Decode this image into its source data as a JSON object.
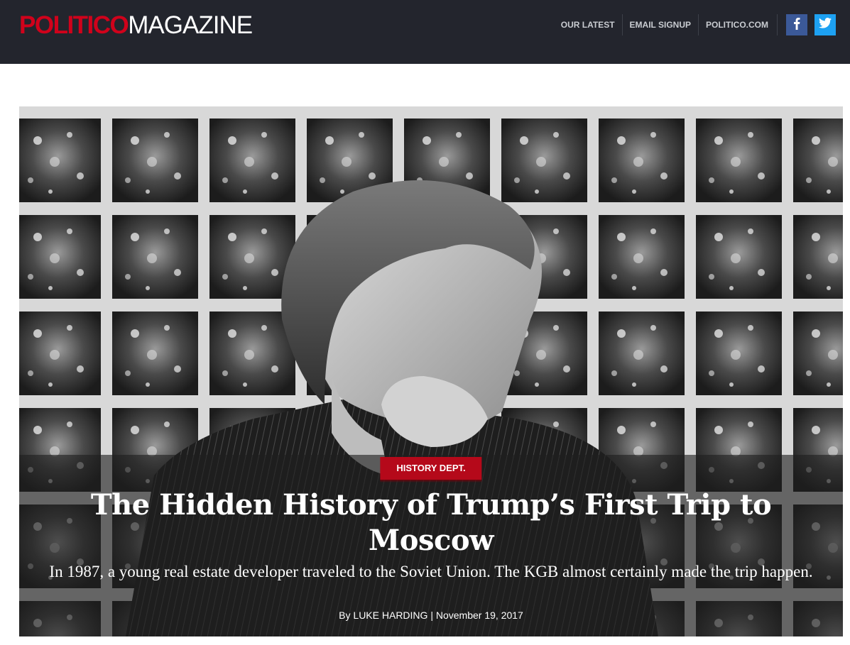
{
  "header": {
    "logo": {
      "part1": "POLITICO",
      "part2": "MAGAZINE"
    },
    "nav": [
      {
        "label": "OUR LATEST"
      },
      {
        "label": "EMAIL SIGNUP"
      },
      {
        "label": "POLITICO.COM"
      }
    ],
    "social": [
      {
        "name": "facebook-icon",
        "glyph": "f",
        "color": "#3b5998"
      },
      {
        "name": "twitter-icon",
        "glyph": "twitter-bird",
        "color": "#1da1f2"
      }
    ]
  },
  "hero": {
    "kicker": "HISTORY DEPT.",
    "headline": "The Hidden History of Trump’s First Trip to Moscow",
    "dek": "In 1987, a young real estate developer traveled to the Soviet Union. The KGB almost certainly made the trip happen.",
    "byline": {
      "prefix": "By",
      "author": "LUKE HARDING",
      "separator": "|",
      "date": "November 19, 2017"
    }
  },
  "colors": {
    "header_bg": "#23252d",
    "brand_red": "#d0021b",
    "kicker_red": "#b5091a"
  }
}
